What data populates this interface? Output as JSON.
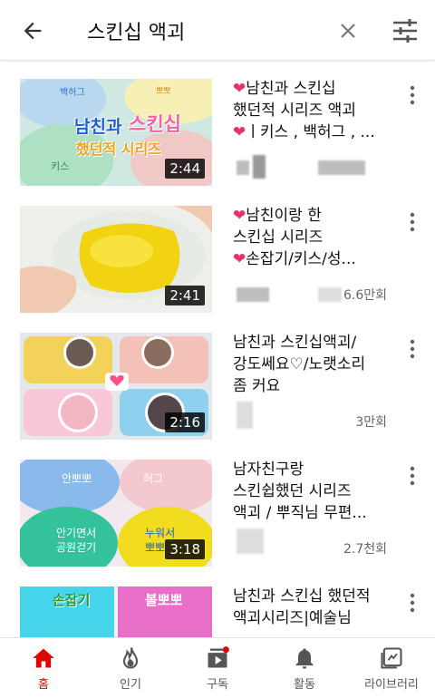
{
  "search": {
    "query": "스킨십 액괴"
  },
  "results": [
    {
      "duration": "2:44",
      "title_lines": [
        "남친과 스킨십",
        "했던적 시리즈 액괴",
        "ㅣ키스 , 백허그 , ..."
      ],
      "views": "",
      "thumb_text": [
        "백허그",
        "뽀뽀",
        "남친과",
        "스킨십",
        "했던적 시리즈",
        "키스"
      ]
    },
    {
      "duration": "2:41",
      "title_lines": [
        "남친이랑 한",
        "스킨십 시리즈",
        "손잡기/키스/성..."
      ],
      "views": "6.6만회"
    },
    {
      "duration": "2:16",
      "title_lines": [
        "남친과 스킨십액괴/",
        "강도쎄요♡/노랫소리",
        "좀 커요"
      ],
      "views": "3만회"
    },
    {
      "duration": "3:18",
      "title_lines": [
        "남자친구랑",
        "스킨쉽했던 시리즈",
        "액괴 / 뿌직님 무편..."
      ],
      "views": "2.7천회",
      "thumb_text": [
        "안뽀뽀",
        "허그",
        "안기면서",
        "공원걷기",
        "누워서",
        "뽀뽀"
      ]
    },
    {
      "duration": "",
      "title_lines": [
        "남친과 스킨십 했던적",
        "액괴시리즈|예술님"
      ],
      "views": "",
      "thumb_text": [
        "손잡기",
        "볼뽀뽀"
      ]
    }
  ],
  "nav": [
    {
      "label": "홈",
      "icon": "home-icon",
      "active": true
    },
    {
      "label": "인기",
      "icon": "fire-icon"
    },
    {
      "label": "구독",
      "icon": "subscriptions-icon"
    },
    {
      "label": "활동",
      "icon": "bell-icon"
    },
    {
      "label": "라이브러리",
      "icon": "library-icon"
    }
  ],
  "colors": {
    "accent": "#e00000",
    "heart": "#e2356a"
  }
}
